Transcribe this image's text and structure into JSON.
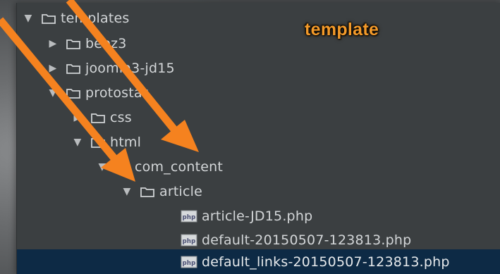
{
  "annotation": {
    "template_label": "template",
    "accent_color": "#f5821f"
  },
  "tree": [
    {
      "label": "templates",
      "expanded": true,
      "type": "folder"
    },
    {
      "label": "beez3",
      "expanded": false,
      "type": "folder"
    },
    {
      "label": "joomla3-jd15",
      "expanded": false,
      "type": "folder"
    },
    {
      "label": "protostar",
      "expanded": true,
      "type": "folder"
    },
    {
      "label": "css",
      "expanded": false,
      "type": "folder"
    },
    {
      "label": "html",
      "expanded": true,
      "type": "folder"
    },
    {
      "label": "com_content",
      "expanded": true,
      "type": "folder"
    },
    {
      "label": "article",
      "expanded": true,
      "type": "folder"
    },
    {
      "label": "article-JD15.php",
      "type": "php"
    },
    {
      "label": "default-20150507-123813.php",
      "type": "php"
    },
    {
      "label": "default_links-20150507-123813.php",
      "type": "php",
      "selected": true
    }
  ],
  "icons": {
    "expanded": "triangle-down-icon",
    "collapsed": "triangle-right-icon",
    "folder": "folder-icon",
    "php": "php-file-icon"
  }
}
